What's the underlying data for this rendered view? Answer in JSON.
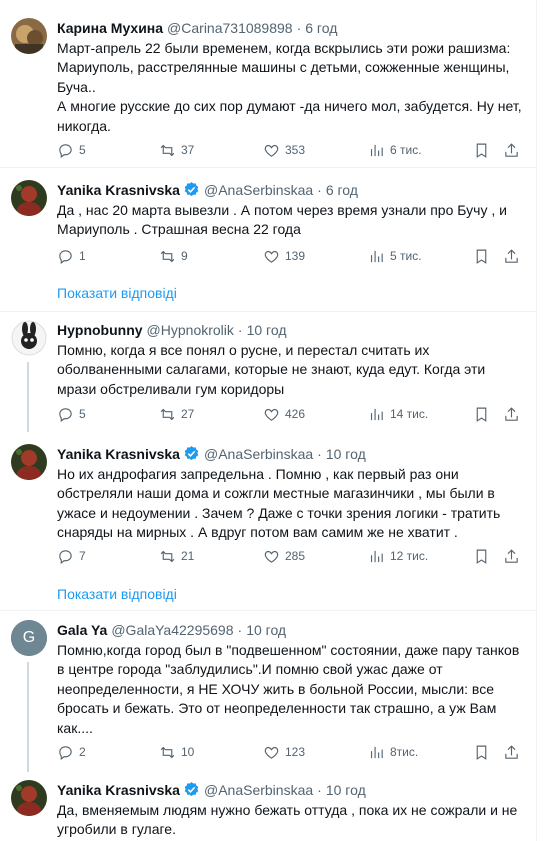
{
  "tweets": [
    {
      "name": "Карина Мухина",
      "handle": "@Carina731089898",
      "time": "6 год",
      "verified": false,
      "text": "Март-апрель 22 были временем, когда вскрылись эти рожи рашизма: Мариуполь, расстрелянные машины с детьми, сожженные женщины, Буча..\nА многие русские до сих пор думают -да ничего мол, забудется. Ну нет, никогда.",
      "replies": "5",
      "retweets": "37",
      "likes": "353",
      "views": "6 тис."
    },
    {
      "name": "Yanika Krasnivska",
      "handle": "@AnaSerbinskaa",
      "time": "6 год",
      "verified": true,
      "text": "Да , нас 20 марта вывезли . А потом через время узнали про Бучу , и Мариуполь . Страшная весна 22 года",
      "replies": "1",
      "retweets": "9",
      "likes": "139",
      "views": "5 тис."
    },
    {
      "name": "Hypnobunny",
      "handle": "@Hypnokrolik",
      "time": "10 год",
      "verified": false,
      "text": "Помню, когда я все понял о русне, и перестал считать их оболваненными салагами, которые не знают, куда едут. Когда эти мрази обстреливали гум коридоры",
      "replies": "5",
      "retweets": "27",
      "likes": "426",
      "views": "14 тис."
    },
    {
      "name": "Yanika Krasnivska",
      "handle": "@AnaSerbinskaa",
      "time": "10 год",
      "verified": true,
      "text": "Но их андрофагия запредельна . Помню , как первый раз они обстреляли наши дома и сожгли местные магазинчики , мы были в ужасе и недоумении . Зачем ? Даже с точки зрения логики - тратить снаряды на мирных . А вдруг потом вам самим же не хватит .",
      "replies": "7",
      "retweets": "21",
      "likes": "285",
      "views": "12 тис."
    },
    {
      "name": "Gala Ya",
      "handle": "@GalaYa42295698",
      "time": "10 год",
      "verified": false,
      "avatar_letter": "G",
      "text": "Помню,когда город был в \"подвешенном\" состоянии, даже пару танков в центре города \"заблудились\".И помню свой ужас даже от неопределенности, я НЕ ХОЧУ жить в больной России, мысли: все бросать и бежать. Это от неопределенности так страшно, а уж Вам как....",
      "replies": "2",
      "retweets": "10",
      "likes": "123",
      "views": "8тис."
    },
    {
      "name": "Yanika Krasnivska",
      "handle": "@AnaSerbinskaa",
      "time": "10 год",
      "verified": true,
      "text": "Да, вменяемым людям нужно бежать оттуда , пока их не сожрали и не угробили в гулаге."
    }
  ],
  "show_replies_label": "Показати відповіді",
  "colors": {
    "accent": "#1d9bf0",
    "secondary_text": "#536471",
    "divider": "#eff3f4"
  },
  "icons": [
    "reply-icon",
    "retweet-icon",
    "like-icon",
    "views-icon",
    "bookmark-icon",
    "share-icon",
    "verified-badge-icon"
  ]
}
